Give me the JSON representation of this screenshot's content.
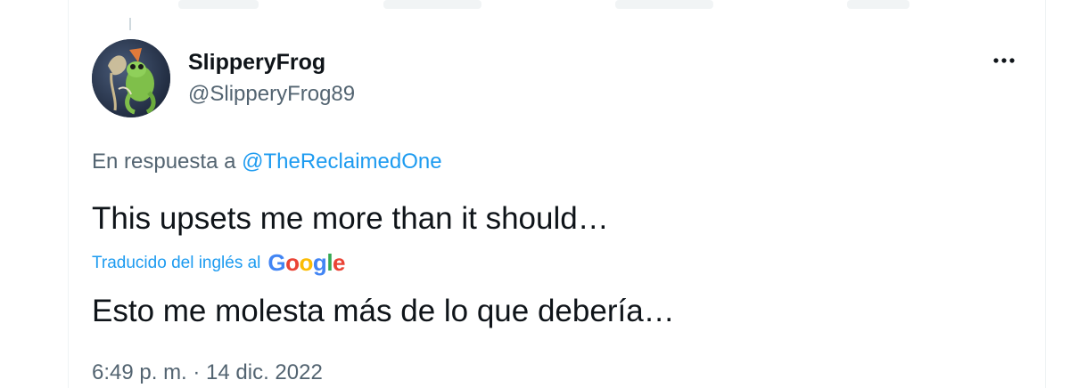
{
  "tweet": {
    "author": {
      "display_name": "SlipperyFrog",
      "handle": "@SlipperyFrog89"
    },
    "more_icon": "more-horizontal-icon",
    "reply_prefix": "En respuesta a",
    "reply_mention": "@TheReclaimedOne",
    "text": "This upsets me more than it should…",
    "translation_label": "Traducido del inglés al",
    "translation_provider": "Google",
    "translated_text": "Esto me molesta más de lo que debería…",
    "timestamp": "6:49 p. m. · 14 dic. 2022"
  },
  "colors": {
    "link": "#1d9bf0",
    "primary_text": "#0f1419",
    "secondary_text": "#536471",
    "google_blue": "#4285F4",
    "google_red": "#EA4335",
    "google_yellow": "#FBBC05",
    "google_green": "#34A853"
  }
}
